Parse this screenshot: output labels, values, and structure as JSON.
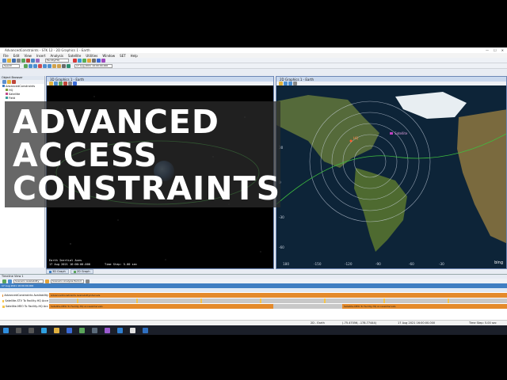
{
  "titlebar": {
    "text": "AdvancedConstraints - STK 12 - 2D Graphics 1 - Earth"
  },
  "menu": [
    "File",
    "Edit",
    "View",
    "Insert",
    "Analysis",
    "Satellite",
    "Utilities",
    "Window",
    "SET",
    "Help"
  ],
  "toolbar": {
    "object_select": "Facility/HQ",
    "date_field": "17 Aug 2021 16:00:00.000",
    "search_placeholder": "Search"
  },
  "object_browser": {
    "title": "Object Browser",
    "items": [
      "AdvancedConstraints",
      "HQ",
      "Satellite",
      "Field"
    ]
  },
  "window3d": {
    "title": "3D Graphics 1 - Earth",
    "readout_frame": "Earth Inertial Axes",
    "readout_time": "17 Aug 2021 16:00:00.000",
    "readout_step": "Time Step: 5.00 sec"
  },
  "window2d": {
    "title": "2D Graphics 1 - Earth",
    "x_ticks": [
      "180",
      "-150",
      "-120",
      "-90",
      "-60",
      "-30"
    ],
    "y_ticks": [
      "30",
      "0",
      "-30",
      "-60"
    ],
    "map_label_facility": "HQ",
    "map_label_sat": "Satellite",
    "attribution": "bing"
  },
  "view_tabs": [
    "3D Graph",
    "2D Graph"
  ],
  "timeline": {
    "title": "Timeline View 1",
    "tool_labels": [
      "Scenario Availability",
      "Scenario Analysis Period"
    ],
    "start_label": "17 Aug 2021 16:00:00.000",
    "rows": [
      {
        "label": "AdvancedConstraints Availability",
        "segment": "AdvancedConstraints AvailabilityIntervals"
      },
      {
        "label": "Satellite-STV To Facility-HQ Acce",
        "segment": ""
      },
      {
        "label": "Satellite-MEO To Facility-HQ Acc",
        "segment": "Satellite-MEO To Facility-HQ AccessIntervals",
        "segment2": "Satellite-MEO To Facility-HQ AccessIntervals"
      }
    ]
  },
  "statusbar": {
    "mode": "2D - Earth",
    "coords": "(-75.47056, -178.77444)",
    "time": "17 Aug 2021 16:00:00.000",
    "step": "Time Step: 5.00 sec"
  },
  "overlay": {
    "lines": [
      "ADVANCED",
      "ACCESS",
      "CONSTRAINTS"
    ]
  },
  "colors": {
    "access_bar": "#e48a2b",
    "timeline_header": "#3f7ec2",
    "orbit": "#3fbf3f"
  }
}
